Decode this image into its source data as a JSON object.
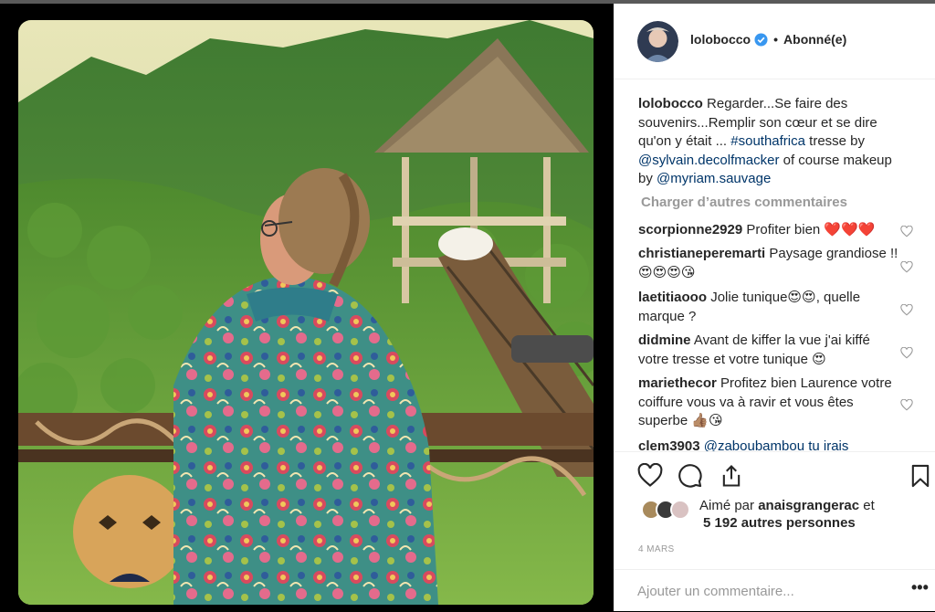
{
  "post": {
    "username": "lolobocco",
    "separator": "•",
    "follow_status": "Abonné(e)",
    "caption": {
      "username": "lolobocco",
      "text_1": "Regarder...Se faire des souvenirs...Remplir son cœur et se dire qu'on y était ... ",
      "hashtag": "#southafrica",
      "text_2": " tresse by ",
      "mention_1": "@sylvain.decolfmacker",
      "text_3": " of course makeup by ",
      "mention_2": "@myriam.sauvage"
    },
    "load_more": "Charger d’autres commentaires",
    "comments": [
      {
        "username": "scorpionne2929",
        "text": "Profiter bien ❤️❤️❤️"
      },
      {
        "username": "christianeperemarti",
        "text": "Paysage grandiose !! 😍😍😍😘"
      },
      {
        "username": "laetitiaooo",
        "text": "Jolie tunique😍😍, quelle marque ?"
      },
      {
        "username": "didmine",
        "text": "Avant de kiffer la vue j'ai kiffé votre tresse et votre tunique 😍"
      },
      {
        "username": "mariethecor",
        "text": "Profitez bien Laurence votre coiffure vous va à ravir et vous êtes superbe 👍🏽😘"
      },
      {
        "username": "clem3903",
        "text": "@zaboubambou tu irais"
      }
    ],
    "likes": {
      "prefix": "Aimé par ",
      "user": "anaisgrangerac",
      "suffix": " et",
      "others": "5 192 autres personnes"
    },
    "date": "4 MARS",
    "add_comment_placeholder": "Ajouter un commentaire...",
    "more_options": "•••"
  },
  "colors": {
    "link": "#003569",
    "verified": "#3897f0",
    "heart_red": "#e0245e",
    "muted": "#999999"
  },
  "icons": [
    "verified-badge-icon",
    "heart-icon",
    "comment-icon",
    "share-icon",
    "bookmark-icon",
    "small-heart-icon",
    "more-options-icon"
  ]
}
